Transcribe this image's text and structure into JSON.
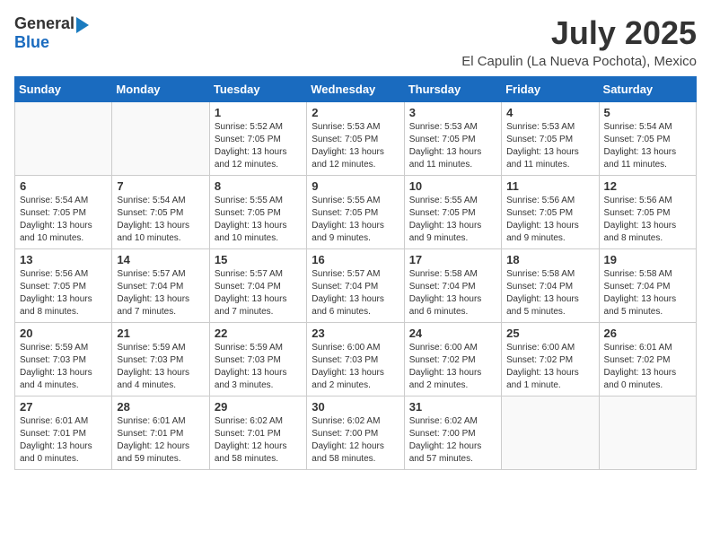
{
  "header": {
    "logo_general": "General",
    "logo_blue": "Blue",
    "month_year": "July 2025",
    "location": "El Capulin (La Nueva Pochota), Mexico"
  },
  "days_of_week": [
    "Sunday",
    "Monday",
    "Tuesday",
    "Wednesday",
    "Thursday",
    "Friday",
    "Saturday"
  ],
  "weeks": [
    [
      {
        "day": "",
        "info": ""
      },
      {
        "day": "",
        "info": ""
      },
      {
        "day": "1",
        "info": "Sunrise: 5:52 AM\nSunset: 7:05 PM\nDaylight: 13 hours\nand 12 minutes."
      },
      {
        "day": "2",
        "info": "Sunrise: 5:53 AM\nSunset: 7:05 PM\nDaylight: 13 hours\nand 12 minutes."
      },
      {
        "day": "3",
        "info": "Sunrise: 5:53 AM\nSunset: 7:05 PM\nDaylight: 13 hours\nand 11 minutes."
      },
      {
        "day": "4",
        "info": "Sunrise: 5:53 AM\nSunset: 7:05 PM\nDaylight: 13 hours\nand 11 minutes."
      },
      {
        "day": "5",
        "info": "Sunrise: 5:54 AM\nSunset: 7:05 PM\nDaylight: 13 hours\nand 11 minutes."
      }
    ],
    [
      {
        "day": "6",
        "info": "Sunrise: 5:54 AM\nSunset: 7:05 PM\nDaylight: 13 hours\nand 10 minutes."
      },
      {
        "day": "7",
        "info": "Sunrise: 5:54 AM\nSunset: 7:05 PM\nDaylight: 13 hours\nand 10 minutes."
      },
      {
        "day": "8",
        "info": "Sunrise: 5:55 AM\nSunset: 7:05 PM\nDaylight: 13 hours\nand 10 minutes."
      },
      {
        "day": "9",
        "info": "Sunrise: 5:55 AM\nSunset: 7:05 PM\nDaylight: 13 hours\nand 9 minutes."
      },
      {
        "day": "10",
        "info": "Sunrise: 5:55 AM\nSunset: 7:05 PM\nDaylight: 13 hours\nand 9 minutes."
      },
      {
        "day": "11",
        "info": "Sunrise: 5:56 AM\nSunset: 7:05 PM\nDaylight: 13 hours\nand 9 minutes."
      },
      {
        "day": "12",
        "info": "Sunrise: 5:56 AM\nSunset: 7:05 PM\nDaylight: 13 hours\nand 8 minutes."
      }
    ],
    [
      {
        "day": "13",
        "info": "Sunrise: 5:56 AM\nSunset: 7:05 PM\nDaylight: 13 hours\nand 8 minutes."
      },
      {
        "day": "14",
        "info": "Sunrise: 5:57 AM\nSunset: 7:04 PM\nDaylight: 13 hours\nand 7 minutes."
      },
      {
        "day": "15",
        "info": "Sunrise: 5:57 AM\nSunset: 7:04 PM\nDaylight: 13 hours\nand 7 minutes."
      },
      {
        "day": "16",
        "info": "Sunrise: 5:57 AM\nSunset: 7:04 PM\nDaylight: 13 hours\nand 6 minutes."
      },
      {
        "day": "17",
        "info": "Sunrise: 5:58 AM\nSunset: 7:04 PM\nDaylight: 13 hours\nand 6 minutes."
      },
      {
        "day": "18",
        "info": "Sunrise: 5:58 AM\nSunset: 7:04 PM\nDaylight: 13 hours\nand 5 minutes."
      },
      {
        "day": "19",
        "info": "Sunrise: 5:58 AM\nSunset: 7:04 PM\nDaylight: 13 hours\nand 5 minutes."
      }
    ],
    [
      {
        "day": "20",
        "info": "Sunrise: 5:59 AM\nSunset: 7:03 PM\nDaylight: 13 hours\nand 4 minutes."
      },
      {
        "day": "21",
        "info": "Sunrise: 5:59 AM\nSunset: 7:03 PM\nDaylight: 13 hours\nand 4 minutes."
      },
      {
        "day": "22",
        "info": "Sunrise: 5:59 AM\nSunset: 7:03 PM\nDaylight: 13 hours\nand 3 minutes."
      },
      {
        "day": "23",
        "info": "Sunrise: 6:00 AM\nSunset: 7:03 PM\nDaylight: 13 hours\nand 2 minutes."
      },
      {
        "day": "24",
        "info": "Sunrise: 6:00 AM\nSunset: 7:02 PM\nDaylight: 13 hours\nand 2 minutes."
      },
      {
        "day": "25",
        "info": "Sunrise: 6:00 AM\nSunset: 7:02 PM\nDaylight: 13 hours\nand 1 minute."
      },
      {
        "day": "26",
        "info": "Sunrise: 6:01 AM\nSunset: 7:02 PM\nDaylight: 13 hours\nand 0 minutes."
      }
    ],
    [
      {
        "day": "27",
        "info": "Sunrise: 6:01 AM\nSunset: 7:01 PM\nDaylight: 13 hours\nand 0 minutes."
      },
      {
        "day": "28",
        "info": "Sunrise: 6:01 AM\nSunset: 7:01 PM\nDaylight: 12 hours\nand 59 minutes."
      },
      {
        "day": "29",
        "info": "Sunrise: 6:02 AM\nSunset: 7:01 PM\nDaylight: 12 hours\nand 58 minutes."
      },
      {
        "day": "30",
        "info": "Sunrise: 6:02 AM\nSunset: 7:00 PM\nDaylight: 12 hours\nand 58 minutes."
      },
      {
        "day": "31",
        "info": "Sunrise: 6:02 AM\nSunset: 7:00 PM\nDaylight: 12 hours\nand 57 minutes."
      },
      {
        "day": "",
        "info": ""
      },
      {
        "day": "",
        "info": ""
      }
    ]
  ]
}
